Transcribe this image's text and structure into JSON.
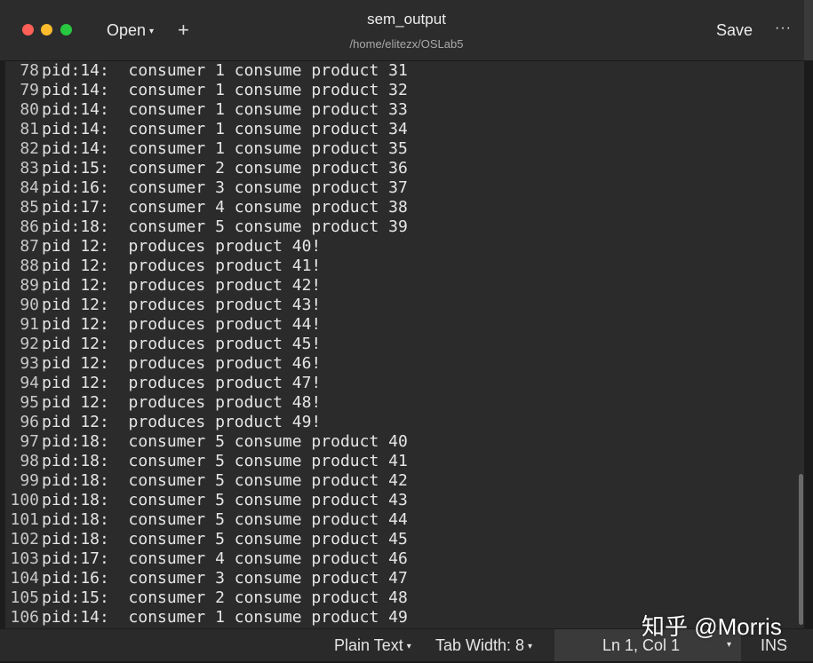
{
  "titlebar": {
    "open_label": "Open",
    "open_caret": "▾",
    "new_tab": "+",
    "title": "sem_output",
    "subtitle": "/home/elitezx/OSLab5",
    "save_label": "Save",
    "more_label": "···"
  },
  "editor": {
    "lines": [
      {
        "n": "78",
        "t": "pid:14:  consumer 1 consume product 31"
      },
      {
        "n": "79",
        "t": "pid:14:  consumer 1 consume product 32"
      },
      {
        "n": "80",
        "t": "pid:14:  consumer 1 consume product 33"
      },
      {
        "n": "81",
        "t": "pid:14:  consumer 1 consume product 34"
      },
      {
        "n": "82",
        "t": "pid:14:  consumer 1 consume product 35"
      },
      {
        "n": "83",
        "t": "pid:15:  consumer 2 consume product 36"
      },
      {
        "n": "84",
        "t": "pid:16:  consumer 3 consume product 37"
      },
      {
        "n": "85",
        "t": "pid:17:  consumer 4 consume product 38"
      },
      {
        "n": "86",
        "t": "pid:18:  consumer 5 consume product 39"
      },
      {
        "n": "87",
        "t": "pid 12:  produces product 40!"
      },
      {
        "n": "88",
        "t": "pid 12:  produces product 41!"
      },
      {
        "n": "89",
        "t": "pid 12:  produces product 42!"
      },
      {
        "n": "90",
        "t": "pid 12:  produces product 43!"
      },
      {
        "n": "91",
        "t": "pid 12:  produces product 44!"
      },
      {
        "n": "92",
        "t": "pid 12:  produces product 45!"
      },
      {
        "n": "93",
        "t": "pid 12:  produces product 46!"
      },
      {
        "n": "94",
        "t": "pid 12:  produces product 47!"
      },
      {
        "n": "95",
        "t": "pid 12:  produces product 48!"
      },
      {
        "n": "96",
        "t": "pid 12:  produces product 49!"
      },
      {
        "n": "97",
        "t": "pid:18:  consumer 5 consume product 40"
      },
      {
        "n": "98",
        "t": "pid:18:  consumer 5 consume product 41"
      },
      {
        "n": "99",
        "t": "pid:18:  consumer 5 consume product 42"
      },
      {
        "n": "100",
        "t": "pid:18:  consumer 5 consume product 43"
      },
      {
        "n": "101",
        "t": "pid:18:  consumer 5 consume product 44"
      },
      {
        "n": "102",
        "t": "pid:18:  consumer 5 consume product 45"
      },
      {
        "n": "103",
        "t": "pid:17:  consumer 4 consume product 46"
      },
      {
        "n": "104",
        "t": "pid:16:  consumer 3 consume product 47"
      },
      {
        "n": "105",
        "t": "pid:15:  consumer 2 consume product 48"
      },
      {
        "n": "106",
        "t": "pid:14:  consumer 1 consume product 49"
      }
    ]
  },
  "statusbar": {
    "language": "Plain Text",
    "tab_width": "Tab Width: 8",
    "position": "Ln 1, Col 1",
    "mode": "INS",
    "caret": "▾"
  },
  "watermark": "知乎 @Morris",
  "colors": {
    "close": "#fe5f57",
    "minimize": "#febc2e",
    "maximize": "#28c840",
    "editor_bg": "#2b2b2b"
  }
}
